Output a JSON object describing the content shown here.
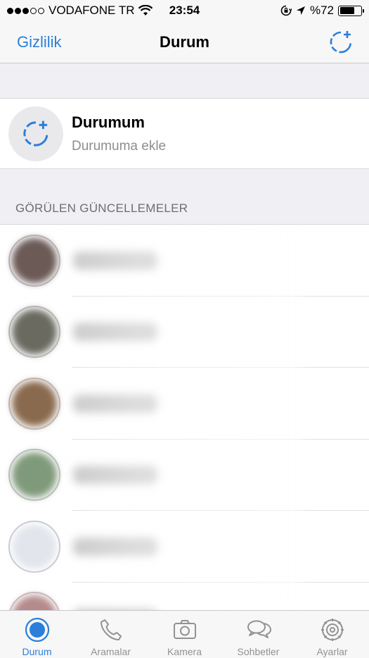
{
  "status_bar": {
    "carrier": "VODAFONE TR",
    "time": "23:54",
    "battery_text": "%72",
    "battery_level": 0.72
  },
  "nav": {
    "left_label": "Gizlilik",
    "title": "Durum",
    "right_icon": "add-status-icon"
  },
  "my_status": {
    "title": "Durumum",
    "subtitle": "Durumuma ekle"
  },
  "updates": {
    "section_title": "GÖRÜLEN GÜNCELLEMELER",
    "rows": [
      {
        "avatar_color": "#6b5a56"
      },
      {
        "avatar_color": "#6a6a60"
      },
      {
        "avatar_color": "#8a6a4e"
      },
      {
        "avatar_color": "#7f9a7a"
      },
      {
        "avatar_color": "#e2e6ec"
      },
      {
        "avatar_color": "#b58a8a"
      }
    ]
  },
  "tabs": [
    {
      "label": "Durum",
      "icon": "status-icon",
      "active": true
    },
    {
      "label": "Aramalar",
      "icon": "phone-icon",
      "active": false
    },
    {
      "label": "Kamera",
      "icon": "camera-icon",
      "active": false
    },
    {
      "label": "Sohbetler",
      "icon": "chat-bubbles-icon",
      "active": false
    },
    {
      "label": "Ayarlar",
      "icon": "gear-icon",
      "active": false
    }
  ],
  "colors": {
    "accent": "#2b7fd9",
    "inactive_tab": "#929292"
  }
}
